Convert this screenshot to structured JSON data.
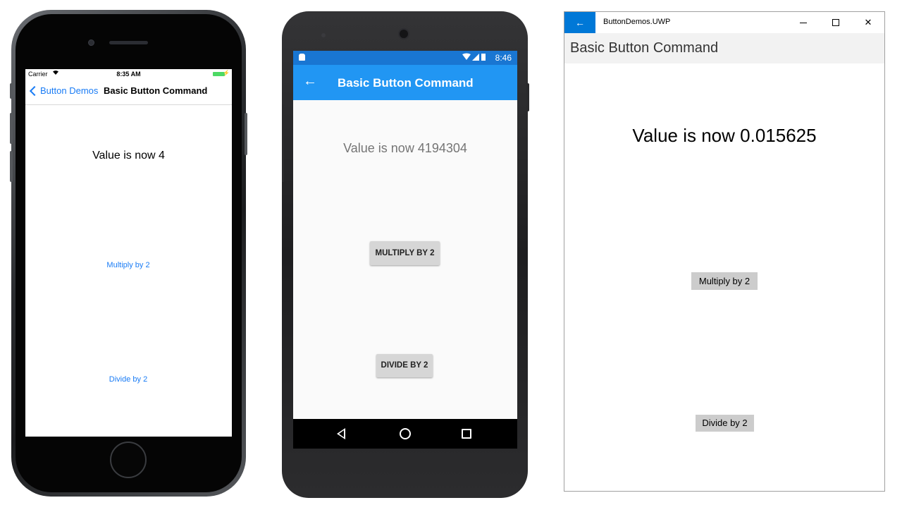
{
  "ios": {
    "status": {
      "carrier": "Carrier",
      "time": "8:35 AM",
      "battery_color": "#4cd964"
    },
    "nav": {
      "back_label": "Button Demos",
      "title": "Basic Button Command"
    },
    "value_text": "Value is now 4",
    "multiply_label": "Multiply by 2",
    "divide_label": "Divide by 2",
    "accent_color": "#1a7cf5"
  },
  "android": {
    "status": {
      "time": "8:46",
      "bar_color": "#1976d2"
    },
    "toolbar": {
      "back_glyph": "←",
      "title": "Basic Button Command",
      "color": "#2196f3"
    },
    "value_text": "Value is now 4194304",
    "multiply_label": "MULTIPLY BY 2",
    "divide_label": "DIVIDE BY 2"
  },
  "uwp": {
    "app_title": "ButtonDemos.UWP",
    "back_glyph": "←",
    "close_glyph": "✕",
    "page_title": "Basic Button Command",
    "value_text": "Value is now 0.015625",
    "multiply_label": "Multiply by 2",
    "divide_label": "Divide by 2",
    "accent_color": "#0078d7"
  }
}
